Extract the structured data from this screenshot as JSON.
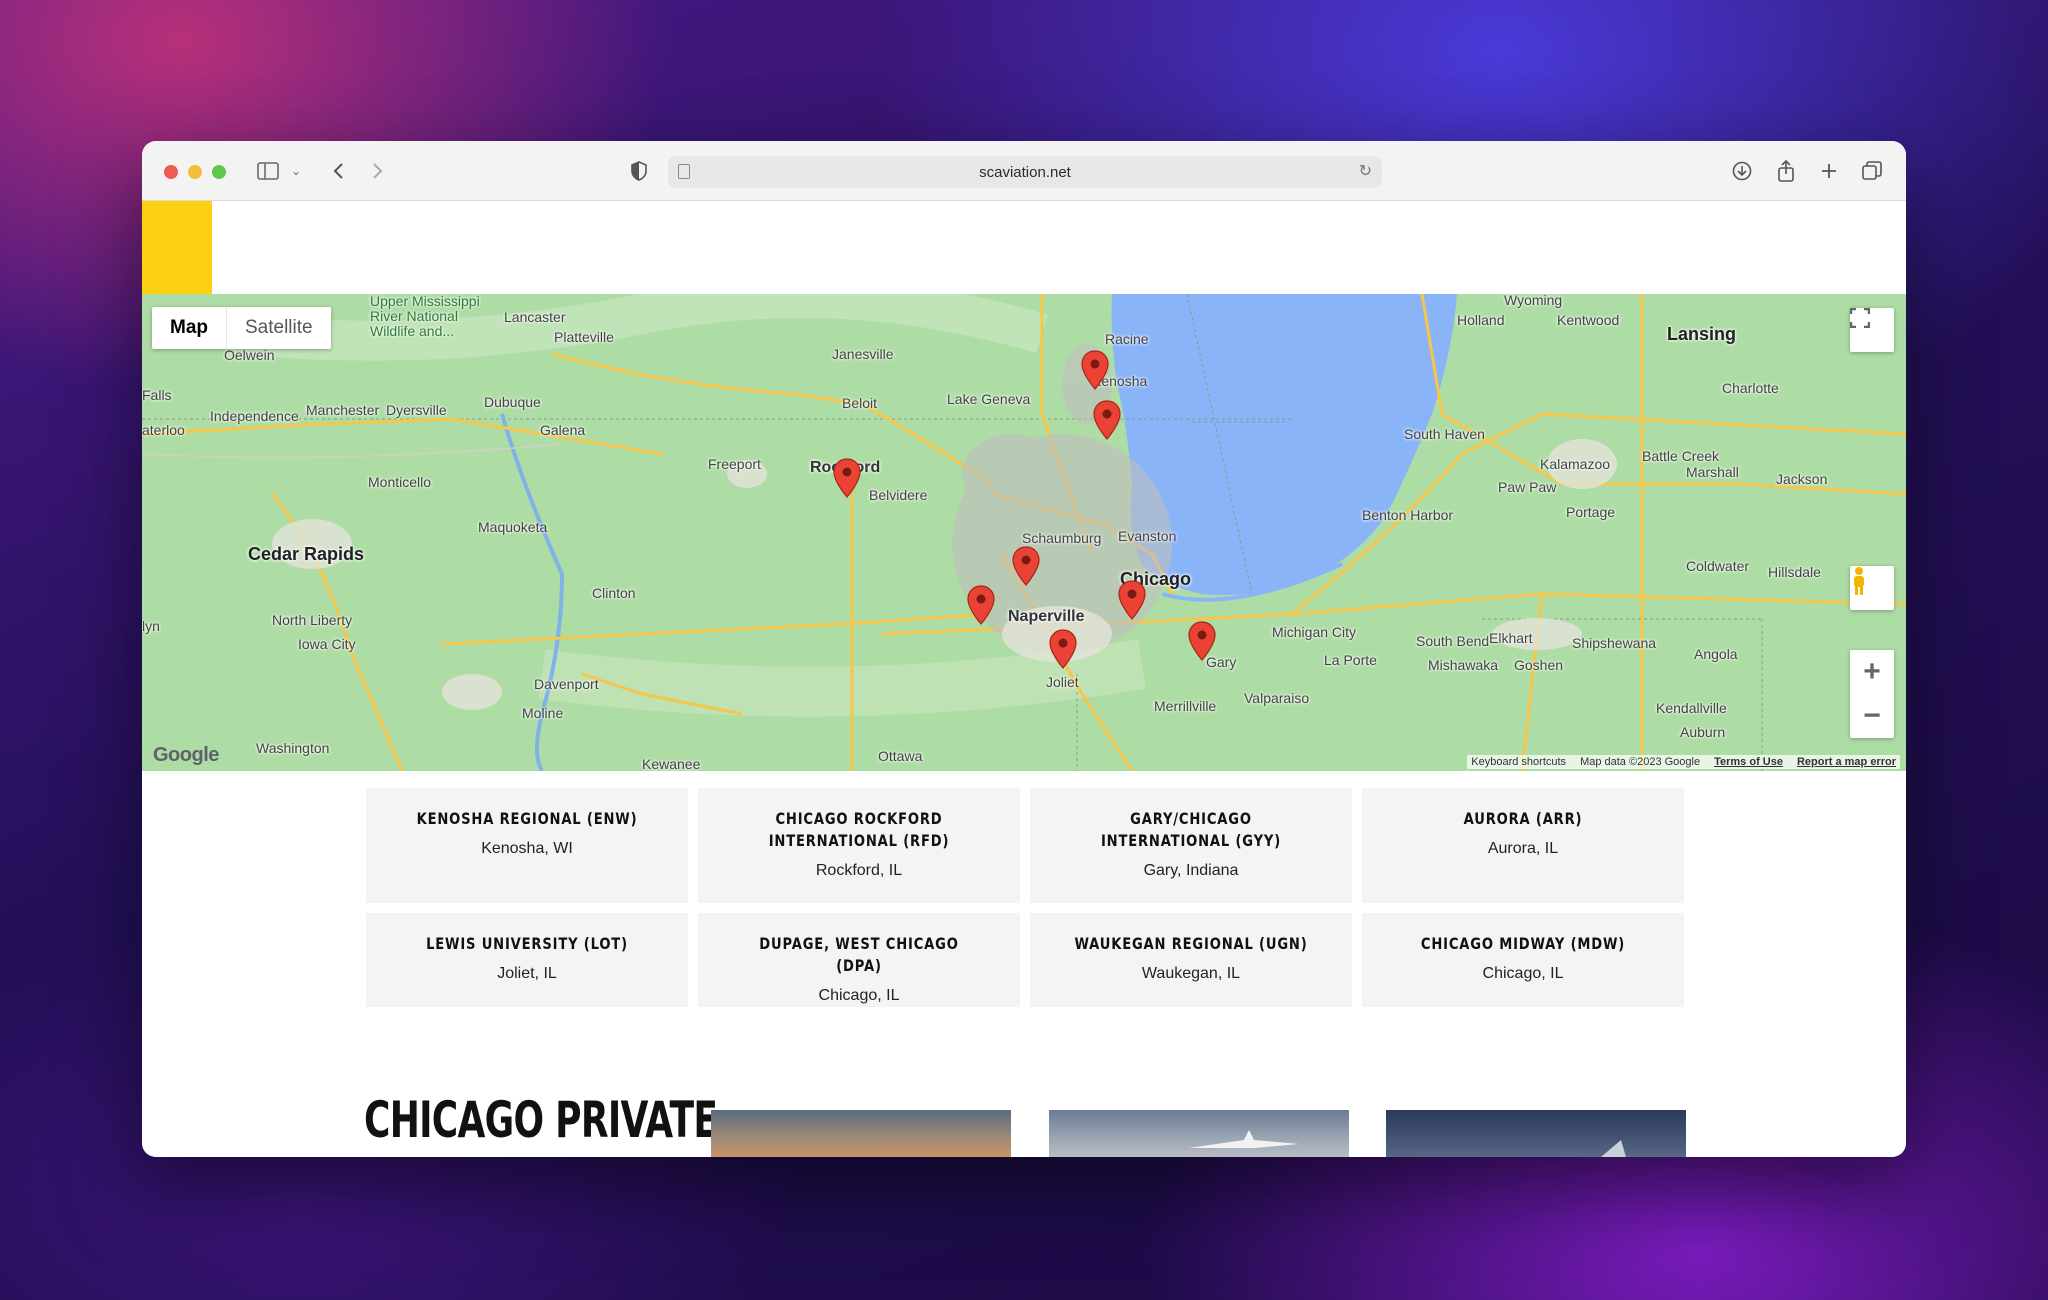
{
  "browser": {
    "url": "scaviation.net"
  },
  "map": {
    "type_controls": [
      "Map",
      "Satellite"
    ],
    "logo": "Google",
    "attribution": [
      "Keyboard shortcuts",
      "Map data ©2023 Google",
      "Terms of Use",
      "Report a map error"
    ],
    "labels": {
      "lansing": "Lansing",
      "wyoming": "Wyoming",
      "holland": "Holland",
      "kentwood": "Kentwood",
      "racine": "Racine",
      "kenosha": "Kenosha",
      "janesville": "Janesville",
      "beloit": "Beloit",
      "lake_geneva": "Lake Geneva",
      "rockford": "Rockford",
      "belvidere": "Belvidere",
      "freeport": "Freeport",
      "schaumburg": "Schaumburg",
      "evanston": "Evanston",
      "chicago": "Chicago",
      "naperville": "Naperville",
      "joliet": "Joliet",
      "gary": "Gary",
      "merrillville": "Merrillville",
      "valparaiso": "Valparaiso",
      "michigan_city": "Michigan City",
      "la_porte": "La Porte",
      "south_bend": "South Bend",
      "elkhart": "Elkhart",
      "mishawaka": "Mishawaka",
      "goshen": "Goshen",
      "shipshewana": "Shipshewana",
      "south_haven": "South Haven",
      "benton_harbor": "Benton Harbor",
      "kalamazoo": "Kalamazoo",
      "battle_creek": "Battle Creek",
      "marshall": "Marshall",
      "jackson": "Jackson",
      "portage": "Portage",
      "paw_paw": "Paw Paw",
      "charlotte": "Charlotte",
      "coldwater": "Coldwater",
      "hillsdale": "Hillsdale",
      "angola": "Angola",
      "kendallville": "Kendallville",
      "auburn": "Auburn",
      "cedar_rapids": "Cedar Rapids",
      "dubuque": "Dubuque",
      "galena": "Galena",
      "dyersville": "Dyersville",
      "manchester": "Manchester",
      "independence": "Independence",
      "oelwein": "Oelwein",
      "monticello": "Monticello",
      "maquoketa": "Maquoketa",
      "clinton": "Clinton",
      "north_liberty": "North Liberty",
      "iowa_city": "Iowa City",
      "davenport": "Davenport",
      "moline": "Moline",
      "washington": "Washington",
      "kewanee": "Kewanee",
      "ottawa": "Ottawa",
      "lancaster": "Lancaster",
      "platteville": "Platteville",
      "upper_mississippi": "Upper Mississippi River National Wildlife and...",
      "waterloo": "aterloo",
      "falls": "Falls",
      "lyn": "lyn"
    }
  },
  "airports": [
    {
      "name": "KENOSHA REGIONAL (ENW)",
      "location": "Kenosha, WI"
    },
    {
      "name": "CHICAGO ROCKFORD INTERNATIONAL (RFD)",
      "location": "Rockford, IL"
    },
    {
      "name": "GARY/CHICAGO INTERNATIONAL (GYY)",
      "location": "Gary, Indiana"
    },
    {
      "name": "AURORA (ARR)",
      "location": "Aurora, IL"
    },
    {
      "name": "LEWIS UNIVERSITY (LOT)",
      "location": "Joliet, IL"
    },
    {
      "name": "DUPAGE, WEST CHICAGO (DPA)",
      "location": "Chicago, IL"
    },
    {
      "name": "WAUKEGAN REGIONAL (UGN)",
      "location": "Waukegan, IL"
    },
    {
      "name": "CHICAGO MIDWAY (MDW)",
      "location": "Chicago, IL"
    }
  ],
  "section": {
    "title": "CHICAGO PRIVATE"
  },
  "colors": {
    "accent_yellow": "#fcd115",
    "pin_red": "#ea4335",
    "lake_blue": "#8ab4f8"
  }
}
